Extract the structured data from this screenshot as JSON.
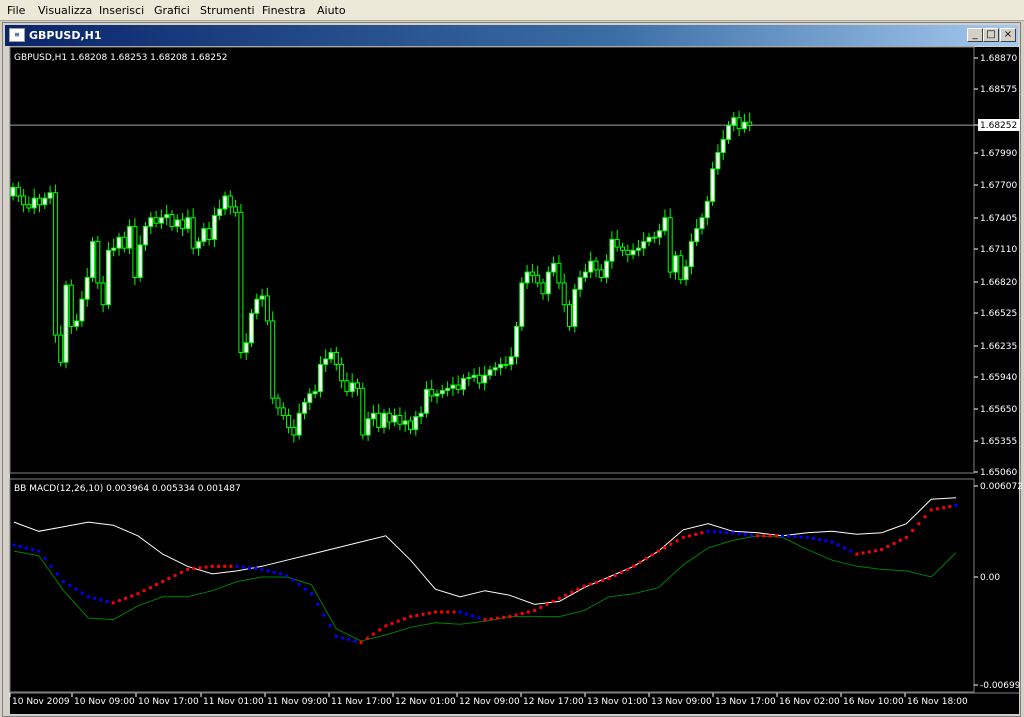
{
  "menu": [
    "File",
    "Visualizza",
    "Inserisci",
    "Grafici",
    "Strumenti",
    "Finestra",
    "Aiuto"
  ],
  "window": {
    "title": "GBPUSD,H1",
    "buttons": [
      "_",
      "□",
      "×"
    ]
  },
  "colors": {
    "background": "#000000",
    "candle": "#00ff00",
    "candle_bull_fill": "#ffffff",
    "upper_band": "#ffffff",
    "lower_band": "#008000",
    "macd_above": "#ff0000",
    "macd_below": "#0000ff",
    "axis_text": "#ffffff",
    "grid": "#808080"
  },
  "chart_data": [
    {
      "type": "candlestick",
      "title": "GBPUSD,H1",
      "header": "GBPUSD,H1  1.68208 1.68253 1.68208 1.68252",
      "current_price": "1.68252",
      "y_tick_labels": [
        "1.68870",
        "1.68575",
        "1.68252",
        "1.67990",
        "1.67700",
        "1.67405",
        "1.67110",
        "1.66820",
        "1.66525",
        "1.66235",
        "1.65940",
        "1.65650",
        "1.65355",
        "1.65060"
      ],
      "ylim": [
        1.6506,
        1.6887
      ],
      "closes": [
        1.6768,
        1.676,
        1.6752,
        1.6749,
        1.6758,
        1.6752,
        1.6758,
        1.6763,
        1.6632,
        1.6607,
        1.6678,
        1.664,
        1.6645,
        1.6665,
        1.6685,
        1.6718,
        1.668,
        1.666,
        1.671,
        1.6712,
        1.6722,
        1.6712,
        1.6732,
        1.6685,
        1.6715,
        1.6732,
        1.674,
        1.6735,
        1.674,
        1.6743,
        1.6732,
        1.6738,
        1.673,
        1.674,
        1.6712,
        1.6718,
        1.673,
        1.672,
        1.6742,
        1.6748,
        1.676,
        1.675,
        1.6745,
        1.6616,
        1.6625,
        1.6652,
        1.6665,
        1.6668,
        1.6645,
        1.6574,
        1.6565,
        1.6558,
        1.6547,
        1.654,
        1.656,
        1.657,
        1.6578,
        1.658,
        1.6605,
        1.661,
        1.6616,
        1.6605,
        1.659,
        1.658,
        1.6588,
        1.6583,
        1.654,
        1.6555,
        1.656,
        1.6547,
        1.656,
        1.6552,
        1.6558,
        1.655,
        1.6553,
        1.6545,
        1.6557,
        1.656,
        1.6582,
        1.6576,
        1.6578,
        1.6581,
        1.6583,
        1.6586,
        1.6582,
        1.6592,
        1.6593,
        1.6595,
        1.6588,
        1.6595,
        1.66,
        1.6602,
        1.6605,
        1.6605,
        1.6612,
        1.664,
        1.668,
        1.669,
        1.6687,
        1.668,
        1.667,
        1.669,
        1.6698,
        1.668,
        1.666,
        1.664,
        1.6674,
        1.6685,
        1.669,
        1.67,
        1.6692,
        1.6685,
        1.67,
        1.672,
        1.6713,
        1.671,
        1.6706,
        1.671,
        1.6712,
        1.6718,
        1.6722,
        1.6722,
        1.6728,
        1.674,
        1.669,
        1.6705,
        1.6683,
        1.6695,
        1.6718,
        1.673,
        1.674,
        1.6755,
        1.6785,
        1.68,
        1.6812,
        1.6825,
        1.6832,
        1.6822,
        1.6828,
        1.6825
      ],
      "x_tick_labels": [
        "10 Nov 2009",
        "10 Nov 09:00",
        "10 Nov 17:00",
        "11 Nov 01:00",
        "11 Nov 09:00",
        "11 Nov 17:00",
        "12 Nov 01:00",
        "12 Nov 09:00",
        "12 Nov 17:00",
        "13 Nov 01:00",
        "13 Nov 09:00",
        "13 Nov 17:00",
        "16 Nov 02:00",
        "16 Nov 10:00",
        "16 Nov 18:00"
      ]
    },
    {
      "type": "line",
      "title": "BB MACD(12,26,10) 0.003964 0.005334 0.001487",
      "y_tick_labels": [
        "0.006072",
        "0.00",
        "-0.00699"
      ],
      "ylim": [
        -0.00699,
        0.006072
      ],
      "series": [
        {
          "name": "upper_band",
          "values": [
            0.0037,
            0.0031,
            0.0034,
            0.0037,
            0.0035,
            0.0028,
            0.0016,
            0.0008,
            0.0003,
            0.0005,
            0.0008,
            0.0012,
            0.0016,
            0.002,
            0.0024,
            0.0028,
            0.0012,
            -0.0007,
            -0.0012,
            -0.0008,
            -0.0011,
            -0.0017,
            -0.0015,
            -0.0006,
            0.0001,
            0.0008,
            0.0018,
            0.0032,
            0.0036,
            0.0031,
            0.003,
            0.0028,
            0.003,
            0.0031,
            0.0029,
            0.003,
            0.0036,
            0.0052,
            0.0053
          ]
        },
        {
          "name": "lower_band",
          "values": [
            0.0018,
            0.0015,
            -0.0008,
            -0.0026,
            -0.0027,
            -0.0018,
            -0.0012,
            -0.0012,
            -0.0008,
            -0.0002,
            0.0001,
            0.0001,
            -0.0004,
            -0.0033,
            -0.0041,
            -0.0037,
            -0.0032,
            -0.0029,
            -0.003,
            -0.0028,
            -0.0025,
            -0.0025,
            -0.0025,
            -0.0021,
            -0.0012,
            -0.001,
            -0.0006,
            0.0009,
            0.002,
            0.0025,
            0.0028,
            0.0027,
            0.0019,
            0.0012,
            0.0008,
            0.0006,
            0.0005,
            0.0001,
            0.0017
          ]
        },
        {
          "name": "macd",
          "values": [
            0.0022,
            0.0018,
            -0.0002,
            -0.0012,
            -0.0016,
            -0.001,
            -0.0002,
            0.0006,
            0.0008,
            0.0008,
            0.0006,
            0.0002,
            -0.001,
            -0.0038,
            -0.0042,
            -0.0031,
            -0.0025,
            -0.0022,
            -0.0022,
            -0.0027,
            -0.0025,
            -0.0021,
            -0.0013,
            -0.0005,
            0.0,
            0.0008,
            0.0018,
            0.0027,
            0.0031,
            0.003,
            0.0028,
            0.0028,
            0.0027,
            0.0024,
            0.0016,
            0.0019,
            0.0027,
            0.0045,
            0.0048
          ]
        }
      ]
    }
  ]
}
